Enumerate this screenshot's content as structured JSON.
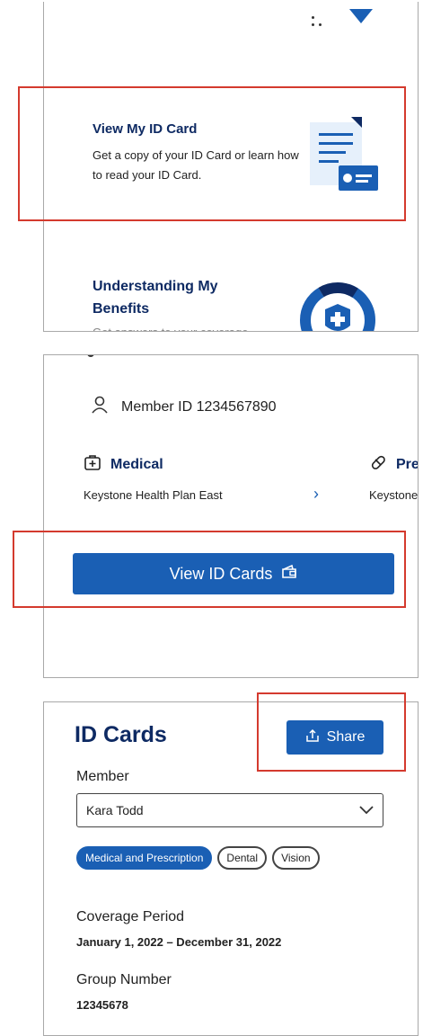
{
  "top_panel": {
    "card1": {
      "title": "View My ID Card",
      "description": "Get a copy of your ID Card or learn how to read your ID Card."
    },
    "card2": {
      "title": "Understanding My Benefits",
      "description": "Get answers to your coverage"
    }
  },
  "middle_panel": {
    "member_label": "Member ID 1234567890",
    "plans": [
      {
        "type": "Medical",
        "name": "Keystone Health Plan East"
      },
      {
        "type": "Pre",
        "name": "Keystone"
      }
    ],
    "view_button": "View ID Cards"
  },
  "bottom_panel": {
    "title": "ID Cards",
    "share_label": "Share",
    "member_field_label": "Member",
    "member_value": "Kara Todd",
    "tabs": [
      "Medical and Prescription",
      "Dental",
      "Vision"
    ],
    "active_tab": "Medical and Prescription",
    "coverage_label": "Coverage Period",
    "coverage_value": "January 1, 2022 – December 31, 2022",
    "group_label": "Group Number",
    "group_value": "12345678"
  },
  "colors": {
    "accent": "#1a5fb4",
    "navy": "#0e2a63",
    "highlight": "#d43a2e"
  }
}
